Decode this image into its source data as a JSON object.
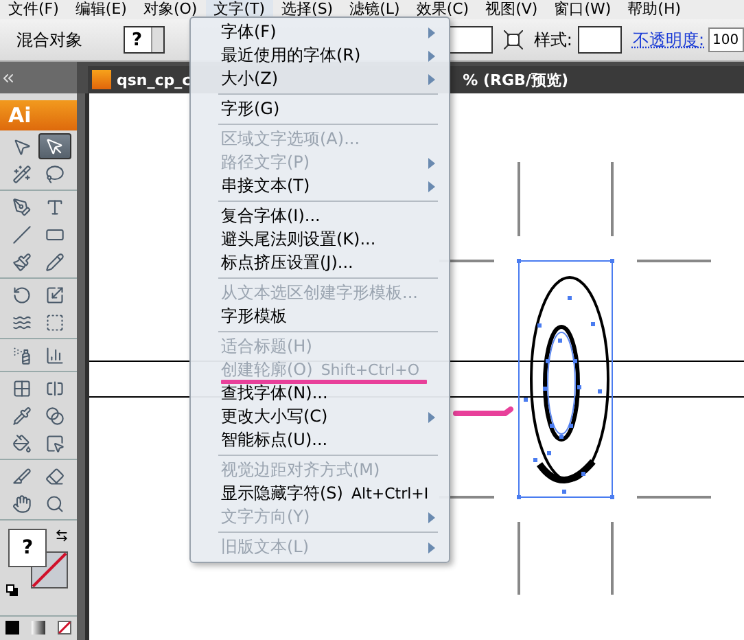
{
  "menubar": [
    {
      "label": "文件(F)",
      "selected": false
    },
    {
      "label": "编辑(E)",
      "selected": false
    },
    {
      "label": "对象(O)",
      "selected": false
    },
    {
      "label": "文字(T)",
      "selected": true
    },
    {
      "label": "选择(S)",
      "selected": false
    },
    {
      "label": "滤镜(L)",
      "selected": false
    },
    {
      "label": "效果(C)",
      "selected": false
    },
    {
      "label": "视图(V)",
      "selected": false
    },
    {
      "label": "窗口(W)",
      "selected": false
    },
    {
      "label": "帮助(H)",
      "selected": false
    }
  ],
  "control_bar": {
    "object_label": "混合对象",
    "fill_value": "?",
    "style_label": "样式:",
    "opacity_link": "不透明度:",
    "opacity_value": "100"
  },
  "document_tab": {
    "title_start": "qsn_cp_c",
    "title_end": "% (RGB/预览)"
  },
  "toolbox": {
    "header": "Ai",
    "fill_value": "?",
    "tools": [
      {
        "selected": false
      },
      {
        "selected": true
      },
      {
        "selected": false
      },
      {
        "selected": false
      },
      {
        "selected": false
      },
      {
        "selected": false
      },
      {
        "selected": false
      },
      {
        "selected": false
      },
      {
        "selected": false
      },
      {
        "selected": false
      },
      {
        "selected": false
      },
      {
        "selected": false
      },
      {
        "selected": false
      },
      {
        "selected": false
      },
      {
        "selected": false
      },
      {
        "selected": false
      },
      {
        "selected": false
      },
      {
        "selected": false
      },
      {
        "selected": false
      },
      {
        "selected": false
      },
      {
        "selected": false
      },
      {
        "selected": false
      },
      {
        "selected": false
      },
      {
        "selected": false
      },
      {
        "selected": false
      },
      {
        "selected": false
      }
    ]
  },
  "menu": {
    "groups": [
      [
        {
          "label": "字体(F)",
          "disabled": false,
          "submenu": true,
          "highlighted": false
        },
        {
          "label": "最近使用的字体(R)",
          "disabled": false,
          "submenu": true,
          "highlighted": false
        },
        {
          "label": "大小(Z)",
          "disabled": false,
          "submenu": true,
          "highlighted": false
        }
      ],
      [
        {
          "label": "字形(G)",
          "disabled": false,
          "submenu": false,
          "highlighted": false
        }
      ],
      [
        {
          "label": "区域文字选项(A)...",
          "disabled": true,
          "submenu": false,
          "highlighted": false
        },
        {
          "label": "路径文字(P)",
          "disabled": true,
          "submenu": true,
          "highlighted": false
        },
        {
          "label": "串接文本(T)",
          "disabled": false,
          "submenu": true,
          "highlighted": false
        }
      ],
      [
        {
          "label": "复合字体(I)...",
          "disabled": false,
          "submenu": false,
          "highlighted": false
        },
        {
          "label": "避头尾法则设置(K)...",
          "disabled": false,
          "submenu": false,
          "highlighted": false
        },
        {
          "label": "标点挤压设置(J)...",
          "disabled": false,
          "submenu": false,
          "highlighted": false
        }
      ],
      [
        {
          "label": "从文本选区创建字形模板...",
          "disabled": true,
          "submenu": false,
          "highlighted": false
        },
        {
          "label": "字形模板",
          "disabled": false,
          "submenu": false,
          "highlighted": false
        }
      ],
      [
        {
          "label": "适合标题(H)",
          "disabled": true,
          "submenu": false,
          "highlighted": false
        },
        {
          "label": "创建轮廓(O)",
          "shortcut": "Shift+Ctrl+O",
          "disabled": true,
          "submenu": false,
          "highlighted": true
        },
        {
          "label": "查找字体(N)...",
          "disabled": false,
          "submenu": false,
          "highlighted": false
        },
        {
          "label": "更改大小写(C)",
          "disabled": false,
          "submenu": true,
          "highlighted": false
        },
        {
          "label": "智能标点(U)...",
          "disabled": false,
          "submenu": false,
          "highlighted": false
        }
      ],
      [
        {
          "label": "视觉边距对齐方式(M)",
          "disabled": true,
          "submenu": false,
          "highlighted": false
        },
        {
          "label": "显示隐藏字符(S)",
          "shortcut": "Alt+Ctrl+I",
          "disabled": false,
          "submenu": false,
          "highlighted": false
        },
        {
          "label": "文字方向(Y)",
          "disabled": true,
          "submenu": true,
          "highlighted": false
        }
      ],
      [
        {
          "label": "旧版文本(L)",
          "disabled": true,
          "submenu": true,
          "highlighted": false
        }
      ]
    ]
  }
}
